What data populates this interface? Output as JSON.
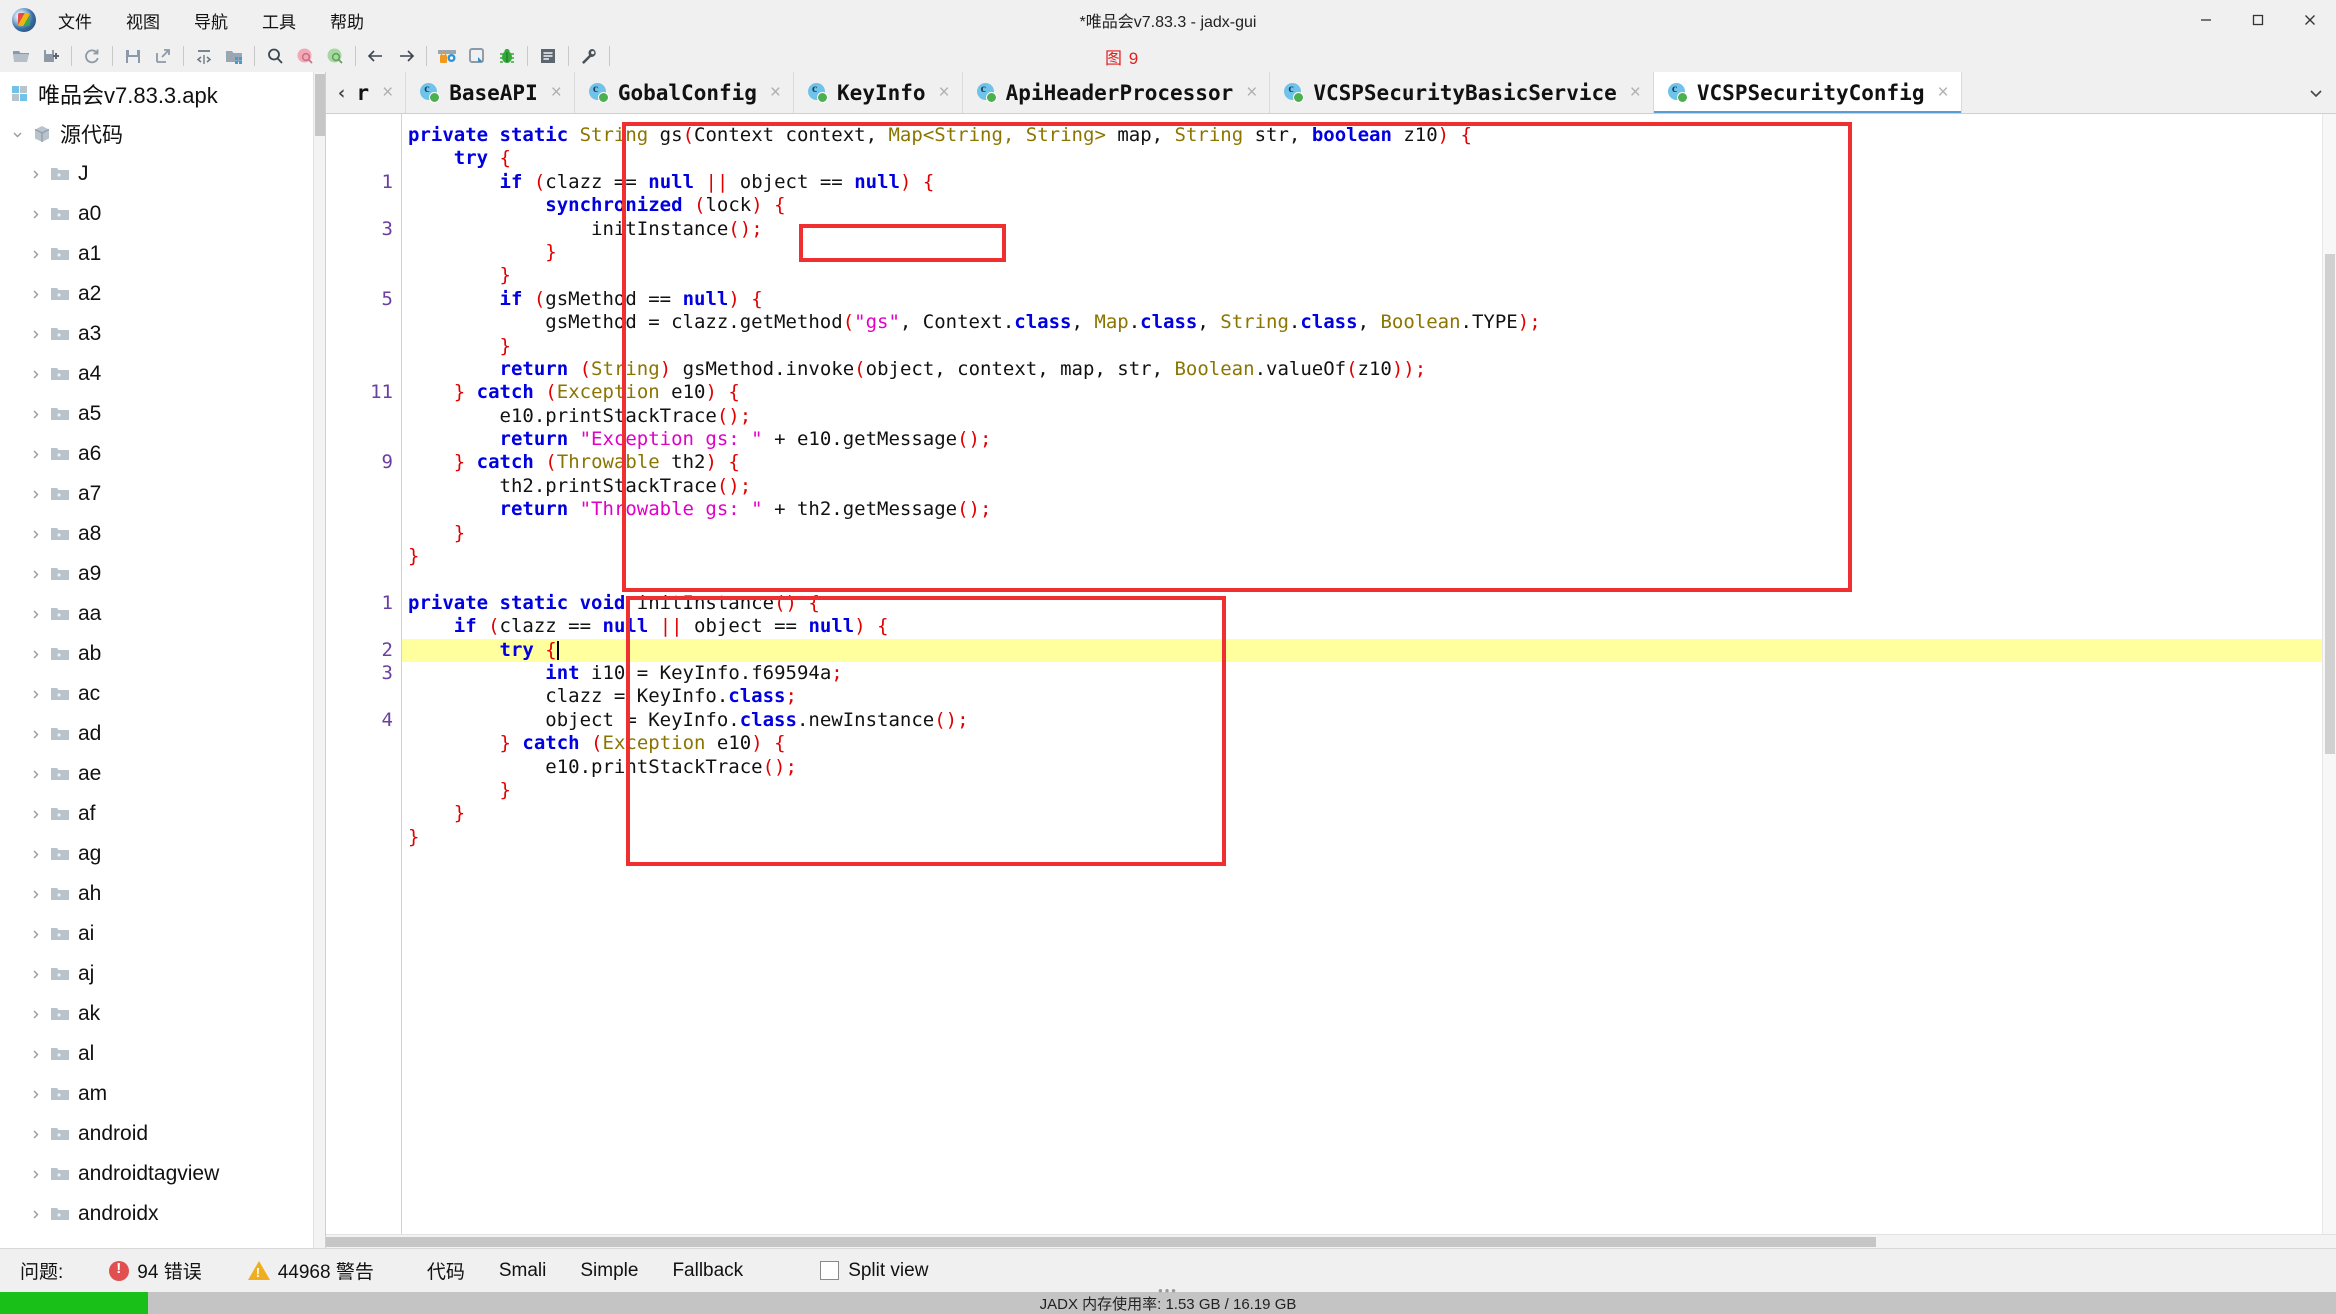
{
  "window": {
    "title": "*唯品会v7.83.3 - jadx-gui",
    "logo_name": "jadx-logo",
    "minimize": "─",
    "maximize": "□",
    "close": "✕"
  },
  "figure_caption": "图 9",
  "menubar": {
    "items": [
      {
        "label": "文件",
        "name": "menu-file"
      },
      {
        "label": "视图",
        "name": "menu-view"
      },
      {
        "label": "导航",
        "name": "menu-navigation"
      },
      {
        "label": "工具",
        "name": "menu-tools"
      },
      {
        "label": "帮助",
        "name": "menu-help"
      }
    ]
  },
  "toolbar": {
    "items": [
      "open-folder-icon",
      "save-all-icon",
      "sep",
      "reload-icon",
      "sep",
      "save-icon",
      "export-icon",
      "sep",
      "collapse-all-icon",
      "open-project-icon",
      "sep",
      "search-icon",
      "search-decompiled-icon",
      "search-resources-icon",
      "sep",
      "back-icon",
      "forward-icon",
      "sep",
      "deobfuscation-icon",
      "quark-icon",
      "debugger-icon",
      "sep",
      "log-icon",
      "sep",
      "preferences-icon",
      "sep"
    ]
  },
  "sidebar": {
    "root": {
      "label": "唯品会v7.83.3.apk",
      "icon": "apk-icon"
    },
    "source_node": {
      "label": "源代码",
      "icon": "package-icon",
      "expanded": true
    },
    "packages": [
      "J",
      "a0",
      "a1",
      "a2",
      "a3",
      "a4",
      "a5",
      "a6",
      "a7",
      "a8",
      "a9",
      "aa",
      "ab",
      "ac",
      "ad",
      "ae",
      "af",
      "ag",
      "ah",
      "ai",
      "aj",
      "ak",
      "al",
      "am",
      "android",
      "androidtagview",
      "androidx"
    ]
  },
  "tabs": {
    "items": [
      {
        "label": "r",
        "active": false,
        "truncated": true
      },
      {
        "label": "BaseAPI",
        "active": false
      },
      {
        "label": "GobalConfig",
        "active": false
      },
      {
        "label": "KeyInfo",
        "active": false
      },
      {
        "label": "ApiHeaderProcessor",
        "active": false
      },
      {
        "label": "VCSPSecurityBasicService",
        "active": false
      },
      {
        "label": "VCSPSecurityConfig",
        "active": true
      }
    ],
    "overflow_icon": "chevron-down-icon"
  },
  "code": {
    "line_numbers": [
      "",
      "",
      "1",
      "",
      "3",
      "",
      "",
      "5",
      "",
      "",
      "",
      "11",
      "",
      "",
      "9",
      "",
      "",
      "",
      "",
      "",
      "1",
      "",
      "2",
      "3",
      "",
      "4",
      "",
      "",
      "",
      ""
    ],
    "lines": [
      [
        {
          "t": "private ",
          "c": "kw"
        },
        {
          "t": "static ",
          "c": "kw"
        },
        {
          "t": "String ",
          "c": "ty"
        },
        {
          "t": "gs",
          "c": "pl"
        },
        {
          "t": "(",
          "c": "p"
        },
        {
          "t": "Context context, ",
          "c": "pl"
        },
        {
          "t": "Map",
          "c": "ty"
        },
        {
          "t": "<",
          "c": "ty"
        },
        {
          "t": "String",
          "c": "ty"
        },
        {
          "t": ", ",
          "c": "ty"
        },
        {
          "t": "String",
          "c": "ty"
        },
        {
          "t": "> ",
          "c": "ty"
        },
        {
          "t": "map, ",
          "c": "pl"
        },
        {
          "t": "String ",
          "c": "ty"
        },
        {
          "t": "str, ",
          "c": "pl"
        },
        {
          "t": "boolean ",
          "c": "kw"
        },
        {
          "t": "z10",
          "c": "pl"
        },
        {
          "t": ") ",
          "c": "p"
        },
        {
          "t": "{",
          "c": "p"
        }
      ],
      [
        {
          "t": "    ",
          "c": "pl"
        },
        {
          "t": "try ",
          "c": "kw"
        },
        {
          "t": "{",
          "c": "p"
        }
      ],
      [
        {
          "t": "        ",
          "c": "pl"
        },
        {
          "t": "if ",
          "c": "kw"
        },
        {
          "t": "(",
          "c": "p"
        },
        {
          "t": "clazz == ",
          "c": "pl"
        },
        {
          "t": "null ",
          "c": "kw"
        },
        {
          "t": "||",
          "c": "p"
        },
        {
          "t": " object == ",
          "c": "pl"
        },
        {
          "t": "null",
          "c": "kw"
        },
        {
          "t": ") ",
          "c": "p"
        },
        {
          "t": "{",
          "c": "p"
        }
      ],
      [
        {
          "t": "            ",
          "c": "pl"
        },
        {
          "t": "synchronized ",
          "c": "kw"
        },
        {
          "t": "(",
          "c": "p"
        },
        {
          "t": "lock",
          "c": "pl"
        },
        {
          "t": ") ",
          "c": "p"
        },
        {
          "t": "{",
          "c": "p"
        }
      ],
      [
        {
          "t": "                initInstance",
          "c": "pl"
        },
        {
          "t": "()",
          "c": "p"
        },
        {
          "t": ";",
          "c": "p"
        }
      ],
      [
        {
          "t": "            ",
          "c": "pl"
        },
        {
          "t": "}",
          "c": "p"
        }
      ],
      [
        {
          "t": "        ",
          "c": "pl"
        },
        {
          "t": "}",
          "c": "p"
        }
      ],
      [
        {
          "t": "        ",
          "c": "pl"
        },
        {
          "t": "if ",
          "c": "kw"
        },
        {
          "t": "(",
          "c": "p"
        },
        {
          "t": "gsMethod == ",
          "c": "pl"
        },
        {
          "t": "null",
          "c": "kw"
        },
        {
          "t": ") ",
          "c": "p"
        },
        {
          "t": "{",
          "c": "p"
        }
      ],
      [
        {
          "t": "            gsMethod = clazz.getMethod",
          "c": "pl"
        },
        {
          "t": "(",
          "c": "p"
        },
        {
          "t": "\"gs\"",
          "c": "st"
        },
        {
          "t": ", Context.",
          "c": "pl"
        },
        {
          "t": "class",
          "c": "kw"
        },
        {
          "t": ", ",
          "c": "pl"
        },
        {
          "t": "Map",
          "c": "ty"
        },
        {
          "t": ".",
          "c": "pl"
        },
        {
          "t": "class",
          "c": "kw"
        },
        {
          "t": ", ",
          "c": "pl"
        },
        {
          "t": "String",
          "c": "ty"
        },
        {
          "t": ".",
          "c": "pl"
        },
        {
          "t": "class",
          "c": "kw"
        },
        {
          "t": ", ",
          "c": "pl"
        },
        {
          "t": "Boolean",
          "c": "ty"
        },
        {
          "t": ".TYPE",
          "c": "pl"
        },
        {
          "t": ")",
          "c": "p"
        },
        {
          "t": ";",
          "c": "p"
        }
      ],
      [
        {
          "t": "        ",
          "c": "pl"
        },
        {
          "t": "}",
          "c": "p"
        }
      ],
      [
        {
          "t": "        ",
          "c": "pl"
        },
        {
          "t": "return ",
          "c": "kw"
        },
        {
          "t": "(",
          "c": "p"
        },
        {
          "t": "String",
          "c": "ty"
        },
        {
          "t": ") ",
          "c": "p"
        },
        {
          "t": "gsMethod.invoke",
          "c": "pl"
        },
        {
          "t": "(",
          "c": "p"
        },
        {
          "t": "object, context, map, str, ",
          "c": "pl"
        },
        {
          "t": "Boolean",
          "c": "ty"
        },
        {
          "t": ".valueOf",
          "c": "pl"
        },
        {
          "t": "(",
          "c": "p"
        },
        {
          "t": "z10",
          "c": "pl"
        },
        {
          "t": "))",
          "c": "p"
        },
        {
          "t": ";",
          "c": "p"
        }
      ],
      [
        {
          "t": "    ",
          "c": "pl"
        },
        {
          "t": "} ",
          "c": "p"
        },
        {
          "t": "catch ",
          "c": "kw"
        },
        {
          "t": "(",
          "c": "p"
        },
        {
          "t": "Exception ",
          "c": "ty"
        },
        {
          "t": "e10",
          "c": "pl"
        },
        {
          "t": ") ",
          "c": "p"
        },
        {
          "t": "{",
          "c": "p"
        }
      ],
      [
        {
          "t": "        e10.printStackTrace",
          "c": "pl"
        },
        {
          "t": "()",
          "c": "p"
        },
        {
          "t": ";",
          "c": "p"
        }
      ],
      [
        {
          "t": "        ",
          "c": "pl"
        },
        {
          "t": "return ",
          "c": "kw"
        },
        {
          "t": "\"Exception gs: \"",
          "c": "st"
        },
        {
          "t": " + e10.getMessage",
          "c": "pl"
        },
        {
          "t": "()",
          "c": "p"
        },
        {
          "t": ";",
          "c": "p"
        }
      ],
      [
        {
          "t": "    ",
          "c": "pl"
        },
        {
          "t": "} ",
          "c": "p"
        },
        {
          "t": "catch ",
          "c": "kw"
        },
        {
          "t": "(",
          "c": "p"
        },
        {
          "t": "Throwable ",
          "c": "ty"
        },
        {
          "t": "th2",
          "c": "pl"
        },
        {
          "t": ") ",
          "c": "p"
        },
        {
          "t": "{",
          "c": "p"
        }
      ],
      [
        {
          "t": "        th2.printStackTrace",
          "c": "pl"
        },
        {
          "t": "()",
          "c": "p"
        },
        {
          "t": ";",
          "c": "p"
        }
      ],
      [
        {
          "t": "        ",
          "c": "pl"
        },
        {
          "t": "return ",
          "c": "kw"
        },
        {
          "t": "\"Throwable gs: \"",
          "c": "st"
        },
        {
          "t": " + th2.getMessage",
          "c": "pl"
        },
        {
          "t": "()",
          "c": "p"
        },
        {
          "t": ";",
          "c": "p"
        }
      ],
      [
        {
          "t": "    ",
          "c": "pl"
        },
        {
          "t": "}",
          "c": "p"
        }
      ],
      [
        {
          "t": "}",
          "c": "p"
        }
      ],
      [
        {
          "t": "",
          "c": "pl"
        }
      ],
      [
        {
          "t": "private ",
          "c": "kw"
        },
        {
          "t": "static ",
          "c": "kw"
        },
        {
          "t": "void ",
          "c": "kw"
        },
        {
          "t": "initInstance",
          "c": "pl"
        },
        {
          "t": "() ",
          "c": "p"
        },
        {
          "t": "{",
          "c": "p"
        }
      ],
      [
        {
          "t": "    ",
          "c": "pl"
        },
        {
          "t": "if ",
          "c": "kw"
        },
        {
          "t": "(",
          "c": "p"
        },
        {
          "t": "clazz == ",
          "c": "pl"
        },
        {
          "t": "null ",
          "c": "kw"
        },
        {
          "t": "||",
          "c": "p"
        },
        {
          "t": " object == ",
          "c": "pl"
        },
        {
          "t": "null",
          "c": "kw"
        },
        {
          "t": ") ",
          "c": "p"
        },
        {
          "t": "{",
          "c": "p"
        }
      ],
      [
        {
          "t": "        ",
          "c": "pl"
        },
        {
          "t": "try ",
          "c": "kw"
        },
        {
          "t": "{",
          "c": "p"
        }
      ],
      [
        {
          "t": "            ",
          "c": "pl"
        },
        {
          "t": "int ",
          "c": "kw"
        },
        {
          "t": "i10 = KeyInfo.f69594a",
          "c": "pl"
        },
        {
          "t": ";",
          "c": "p"
        }
      ],
      [
        {
          "t": "            clazz = KeyInfo.",
          "c": "pl"
        },
        {
          "t": "class",
          "c": "kw"
        },
        {
          "t": ";",
          "c": "p"
        }
      ],
      [
        {
          "t": "            object = KeyInfo.",
          "c": "pl"
        },
        {
          "t": "class",
          "c": "kw"
        },
        {
          "t": ".newInstance",
          "c": "pl"
        },
        {
          "t": "()",
          "c": "p"
        },
        {
          "t": ";",
          "c": "p"
        }
      ],
      [
        {
          "t": "        ",
          "c": "pl"
        },
        {
          "t": "} ",
          "c": "p"
        },
        {
          "t": "catch ",
          "c": "kw"
        },
        {
          "t": "(",
          "c": "p"
        },
        {
          "t": "Exception ",
          "c": "ty"
        },
        {
          "t": "e10",
          "c": "pl"
        },
        {
          "t": ") ",
          "c": "p"
        },
        {
          "t": "{",
          "c": "p"
        }
      ],
      [
        {
          "t": "            e10.printStackTrace",
          "c": "pl"
        },
        {
          "t": "()",
          "c": "p"
        },
        {
          "t": ";",
          "c": "p"
        }
      ],
      [
        {
          "t": "        ",
          "c": "pl"
        },
        {
          "t": "}",
          "c": "p"
        }
      ],
      [
        {
          "t": "    ",
          "c": "pl"
        },
        {
          "t": "}",
          "c": "p"
        }
      ],
      [
        {
          "t": "}",
          "c": "p"
        }
      ]
    ],
    "highlight_line_index": 22,
    "caret_line_text": "try {"
  },
  "annotations": {
    "boxes": [
      {
        "name": "gs-method-box"
      },
      {
        "name": "initinstance-call-box"
      },
      {
        "name": "initinstance-method-box"
      }
    ],
    "color": "#f03030"
  },
  "statusbar": {
    "problems_label": "问题:",
    "errors": "94 错误",
    "warnings": "44968 警告",
    "modes": [
      "代码",
      "Smali",
      "Simple",
      "Fallback"
    ],
    "split_view_label": "Split view",
    "split_view_checked": false
  },
  "memorybar": {
    "text": "JADX 内存使用率: 1.53 GB / 16.19 GB",
    "used_gb": "1.53 GB",
    "total_gb": "16.19 GB",
    "fill_color": "#18c018"
  }
}
